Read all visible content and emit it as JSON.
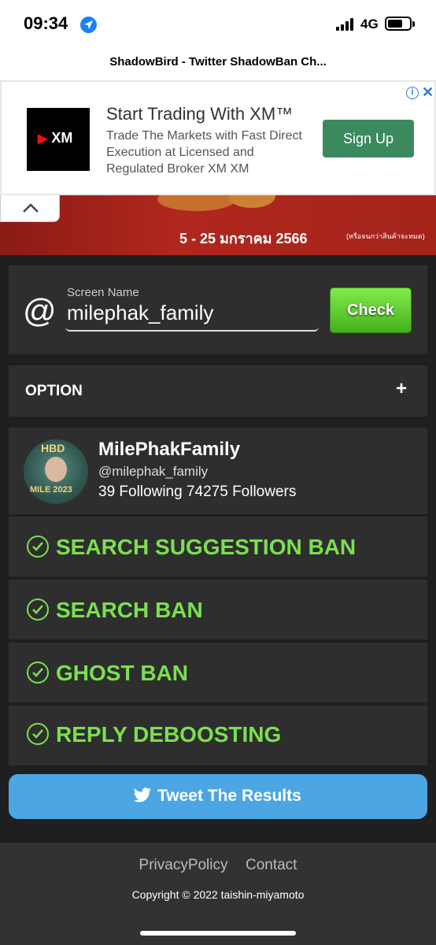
{
  "status_bar": {
    "time": "09:34",
    "network": "4G"
  },
  "browser": {
    "page_title": "ShadowBird - Twitter ShadowBan Ch..."
  },
  "ad": {
    "brand": "XM",
    "title": "Start Trading With XM™",
    "body": "Trade The Markets with Fast Direct Execution at Licensed and Regulated Broker XM XM",
    "button": "Sign Up",
    "info_glyph": "i",
    "close_glyph": "✕"
  },
  "banner": {
    "text": "5 - 25 มกราคม 2566",
    "small_text": "(หรือจนกว่าสินค้าจะหมด)"
  },
  "search": {
    "at_symbol": "@",
    "label": "Screen Name",
    "value": "milephak_family",
    "button": "Check"
  },
  "option": {
    "label": "OPTION",
    "toggle": "+"
  },
  "profile": {
    "avatar_top": "HBD",
    "avatar_bottom": "MILE 2023",
    "name": "MilePhakFamily",
    "handle": "@milephak_family",
    "stats": "39 Following 74275 Followers"
  },
  "results": [
    {
      "label": "SEARCH SUGGESTION BAN"
    },
    {
      "label": "SEARCH BAN"
    },
    {
      "label": "GHOST BAN"
    },
    {
      "label": "REPLY DEBOOSTING"
    }
  ],
  "tweet_button": "Tweet The Results",
  "footer": {
    "privacy": "PrivacyPolicy",
    "contact": "Contact",
    "copyright": "Copyright © 2022 taishin-miyamoto"
  },
  "colors": {
    "ok_green": "#7be04f",
    "check_button": "#5fcf2f",
    "tweet_blue": "#4ba6e3",
    "ad_button": "#3a8a5e"
  }
}
